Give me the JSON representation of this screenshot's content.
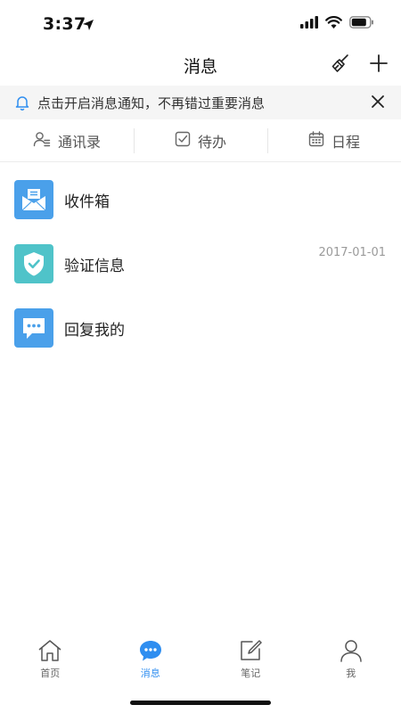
{
  "status_bar": {
    "time": "3:37"
  },
  "nav": {
    "title": "消息",
    "icons": [
      "broom-icon",
      "plus-icon"
    ]
  },
  "notice": {
    "text": "点击开启消息通知，不再错过重要消息",
    "icons": [
      "bell-icon",
      "close-icon"
    ]
  },
  "quick_tabs": [
    {
      "label": "通讯录",
      "icon": "contacts-icon"
    },
    {
      "label": "待办",
      "icon": "checkbox-icon"
    },
    {
      "label": "日程",
      "icon": "calendar-icon"
    }
  ],
  "messages": [
    {
      "title": "收件箱",
      "date": "",
      "icon": "mail-icon",
      "icon_color": "#4aa0ea"
    },
    {
      "title": "验证信息",
      "date": "2017-01-01",
      "icon": "shield-check-icon",
      "icon_color": "#4fc3c9"
    },
    {
      "title": "回复我的",
      "date": "",
      "icon": "chat-bubble-icon",
      "icon_color": "#4aa0ea"
    }
  ],
  "tab_bar": [
    {
      "label": "首页",
      "icon": "home-icon",
      "active": false
    },
    {
      "label": "消息",
      "icon": "message-icon",
      "active": true
    },
    {
      "label": "笔记",
      "icon": "note-icon",
      "active": false
    },
    {
      "label": "我",
      "icon": "user-icon",
      "active": false
    }
  ],
  "colors": {
    "accent": "#2f8ef0",
    "notice_bg": "#f5f5f5"
  }
}
